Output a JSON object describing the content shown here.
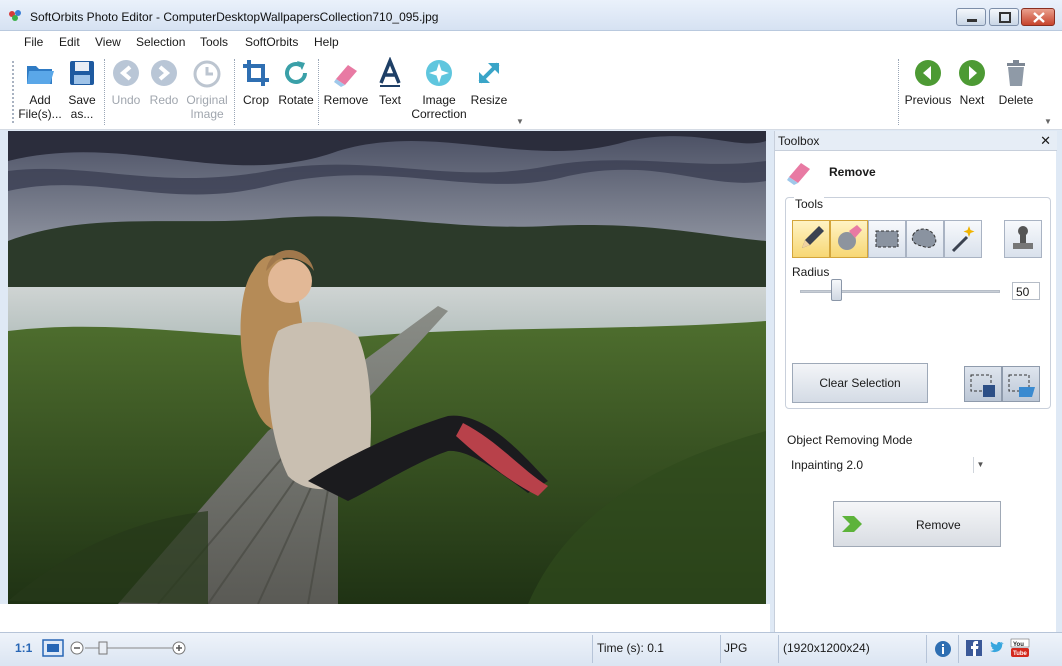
{
  "window": {
    "title": "SoftOrbits Photo Editor - ComputerDesktopWallpapersCollection710_095.jpg"
  },
  "menu": {
    "items": [
      {
        "label": "File"
      },
      {
        "label": "Edit"
      },
      {
        "label": "View"
      },
      {
        "label": "Selection"
      },
      {
        "label": "Tools"
      },
      {
        "label": "SoftOrbits"
      },
      {
        "label": "Help"
      }
    ]
  },
  "toolbar": {
    "add_files_l1": "Add",
    "add_files_l2": "File(s)...",
    "save_as_l1": "Save",
    "save_as_l2": "as...",
    "undo": "Undo",
    "redo": "Redo",
    "original_l1": "Original",
    "original_l2": "Image",
    "crop": "Crop",
    "rotate": "Rotate",
    "remove": "Remove",
    "text": "Text",
    "correction_l1": "Image",
    "correction_l2": "Correction",
    "resize": "Resize",
    "previous": "Previous",
    "next": "Next",
    "delete": "Delete"
  },
  "toolbox": {
    "header": "Toolbox",
    "section_title": "Remove",
    "tools_legend": "Tools",
    "radius_label": "Radius",
    "radius_value": "50",
    "radius_fraction": 0.18,
    "clear_selection": "Clear Selection",
    "mode_label": "Object Removing Mode",
    "mode_value": "Inpainting 2.0",
    "remove_button": "Remove"
  },
  "statusbar": {
    "zoom_ratio": "1:1",
    "time": "Time (s): 0.1",
    "format": "JPG",
    "dimensions": "(1920x1200x24)"
  },
  "colors": {
    "accent": "#3a7fc8",
    "green": "#4d9a34",
    "window_bg": "#dfe9f5"
  }
}
